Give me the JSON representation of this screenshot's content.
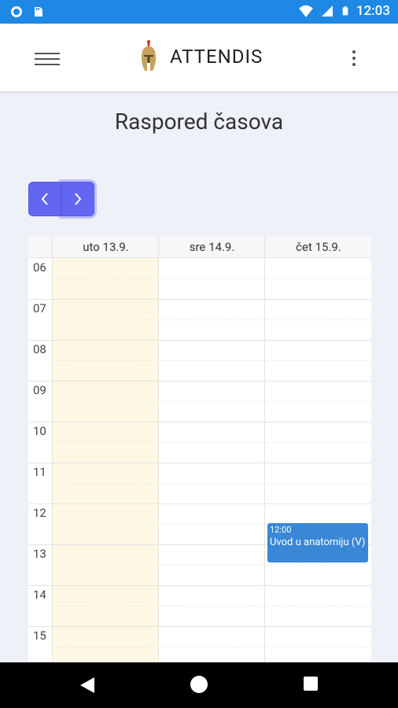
{
  "status_bar": {
    "time": "12:03",
    "icons": [
      "sync-icon",
      "sd-card-icon",
      "wifi-icon",
      "signal-icon",
      "battery-icon"
    ]
  },
  "app_bar": {
    "title": "ATTENDIS",
    "icons": [
      "menu-icon",
      "helmet-logo",
      "more-vert-icon"
    ]
  },
  "page": {
    "title": "Raspored časova"
  },
  "navigation": {
    "prev_icon": "chevron-left-icon",
    "next_icon": "chevron-right-icon",
    "accent": "#6366f1"
  },
  "calendar": {
    "days": [
      "uto 13.9.",
      "sre 14.9.",
      "čet 15.9."
    ],
    "hours": [
      "06",
      "07",
      "08",
      "09",
      "10",
      "11",
      "12",
      "13",
      "14",
      "15"
    ],
    "today_color": "#fdf8e3",
    "events": [
      {
        "time": "12:00",
        "title": "Uvod u anatomiju (V)",
        "day": "čet 15.9.",
        "color": "#3a87d6"
      }
    ]
  },
  "system_nav": {
    "icons": [
      "back-icon",
      "home-icon",
      "recents-icon"
    ]
  },
  "colors": {
    "status_bar": "#1e88e5",
    "background": "#eef1f7"
  }
}
